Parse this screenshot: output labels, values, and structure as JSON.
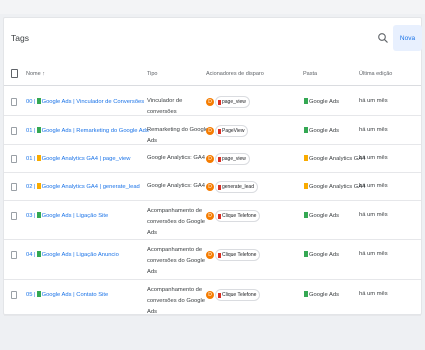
{
  "card": {
    "title": "Tags",
    "new_button": "Nova"
  },
  "columns": {
    "name": "Nome",
    "sort": "↑",
    "type": "Tipo",
    "triggers": "Acionadores de disparo",
    "folder": "Pasta",
    "last_edit": "Última edição"
  },
  "colors": {
    "ads_green": "#34a853",
    "ga4_orange": "#f9ab00",
    "trigger_red": "#d93025",
    "link_blue": "#1a73e8"
  },
  "icons": {
    "search": "search-icon",
    "trigger": "trigger-icon",
    "checkbox": "checkbox-icon"
  },
  "rows": [
    {
      "prefix": "00 |",
      "tag": "Google Ads | Vinculador de Conversões",
      "tag_color": "green",
      "type": "Vinculador de conversões",
      "trigger_letter": "D",
      "trigger": "page_view",
      "folder": "Google Ads",
      "folder_color": "green",
      "edited": "há um mês"
    },
    {
      "prefix": "01 |",
      "tag": "Google Ads | Remarketing do Google Ads",
      "tag_color": "green",
      "type": "Remarketing do Google Ads",
      "trigger_letter": "D",
      "trigger": "PageView",
      "folder": "Google Ads",
      "folder_color": "green",
      "edited": "há um mês"
    },
    {
      "prefix": "01 |",
      "tag": "Google Analytics GA4 | page_view",
      "tag_color": "orange",
      "type": "Google Analytics: GA4",
      "trigger_letter": "D",
      "trigger": "page_view",
      "folder": "Google Analytics GA4",
      "folder_color": "orange",
      "edited": "há um mês"
    },
    {
      "prefix": "02 |",
      "tag": "Google Analytics GA4 | generate_lead",
      "tag_color": "orange",
      "type": "Google Analytics: GA4",
      "trigger_letter": "D",
      "trigger": "generate_lead",
      "folder": "Google Analytics GA4",
      "folder_color": "orange",
      "edited": "há um mês"
    },
    {
      "prefix": "03 |",
      "tag": "Google Ads | Ligação Site",
      "tag_color": "green",
      "type": "Acompanhamento de conversões do Google Ads",
      "trigger_letter": "D",
      "trigger": "Clique Telefone",
      "folder": "Google Ads",
      "folder_color": "green",
      "edited": "há um mês"
    },
    {
      "prefix": "04 |",
      "tag": "Google Ads | Ligação Anuncio",
      "tag_color": "green",
      "type": "Acompanhamento de conversões do Google Ads",
      "trigger_letter": "D",
      "trigger": "Clique Telefone",
      "folder": "Google Ads",
      "folder_color": "green",
      "edited": "há um mês"
    },
    {
      "prefix": "05 |",
      "tag": "Google Ads | Contato Site",
      "tag_color": "green",
      "type": "Acompanhamento de conversões do Google Ads",
      "trigger_letter": "D",
      "trigger": "Clique Telefone",
      "folder": "Google Ads",
      "folder_color": "green",
      "edited": "há um mês"
    }
  ]
}
